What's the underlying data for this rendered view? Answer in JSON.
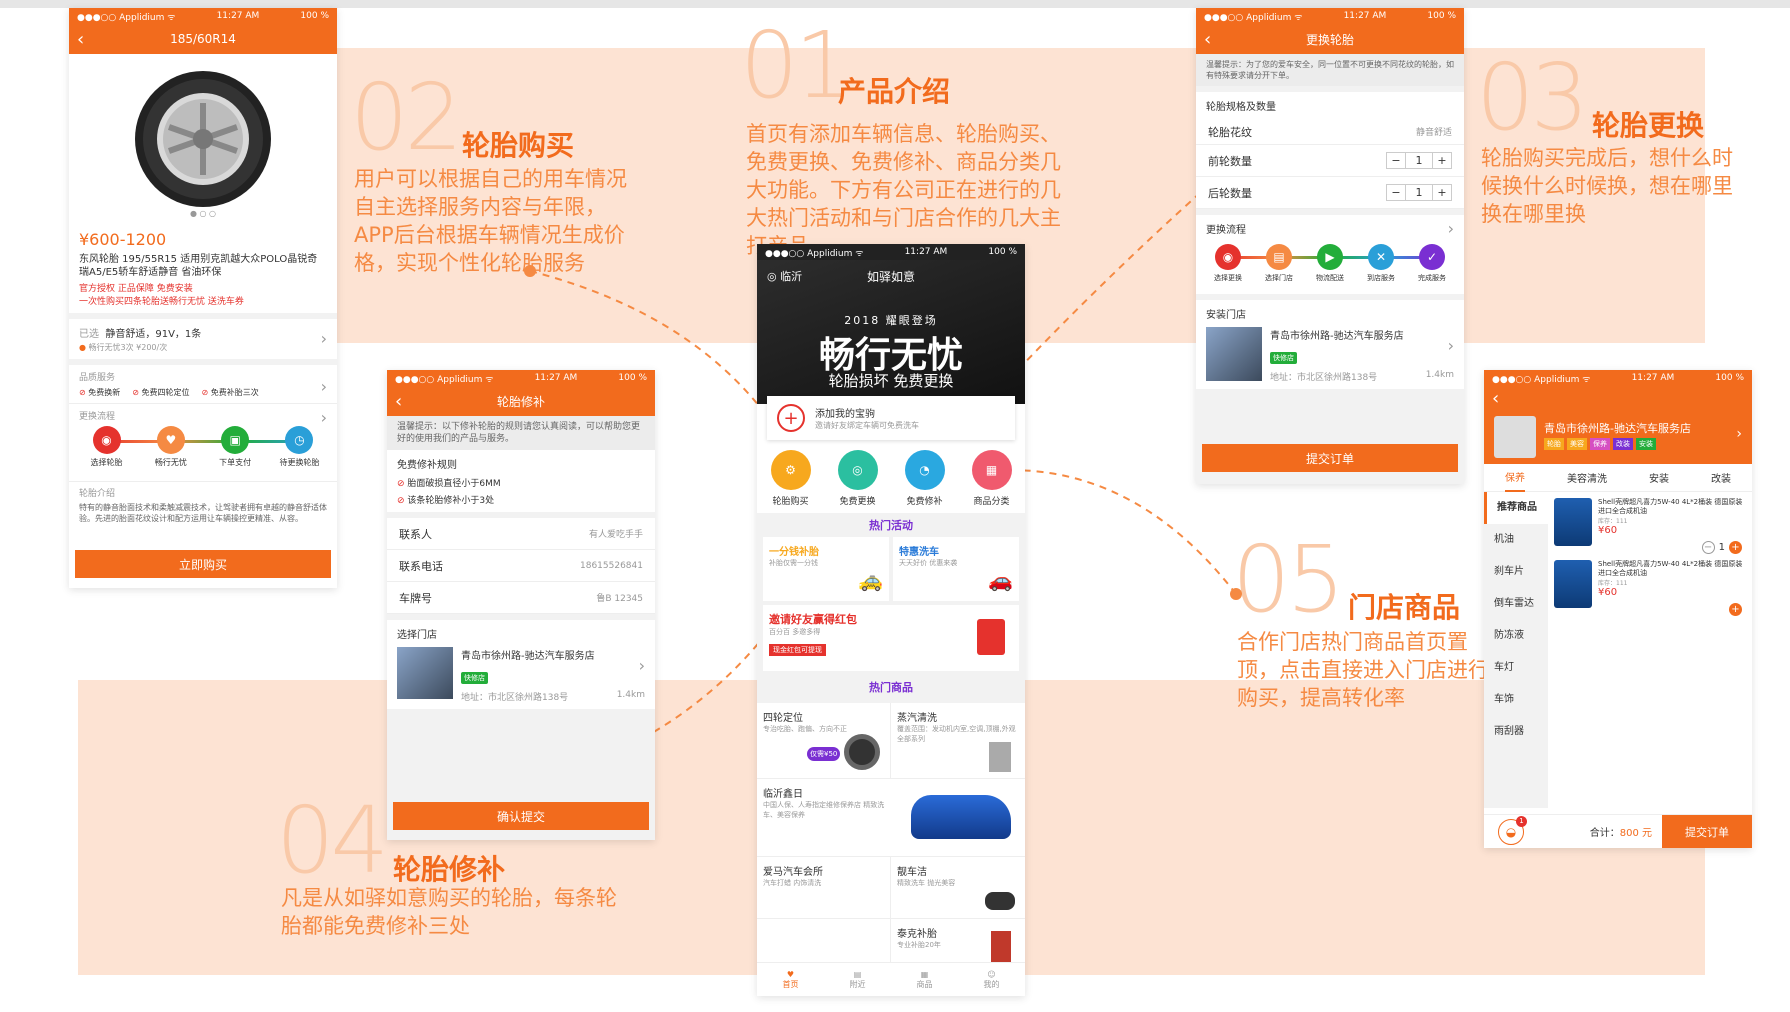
{
  "features": {
    "f01": {
      "num": "01",
      "title": "产品介绍",
      "desc": "首页有添加车辆信息、轮胎购买、免费更换、免费修补、商品分类几大功能。下方有公司正在进行的几大热门活动和与门店合作的几大主打产品"
    },
    "f02": {
      "num": "02",
      "title": "轮胎购买",
      "desc": "用户可以根据自己的用车情况自主选择服务内容与年限，APP后台根据车辆情况生成价格，实现个性化轮胎服务"
    },
    "f03": {
      "num": "03",
      "title": "轮胎更换",
      "desc": "轮胎购买完成后，想什么时候换什么时候换，想在哪里换在哪里换"
    },
    "f04": {
      "num": "04",
      "title": "轮胎修补",
      "desc": "凡是从如驿如意购买的轮胎，每条轮胎都能免费修补三处"
    },
    "f05": {
      "num": "05",
      "title": "门店商品",
      "desc": "合作门店热门商品首页置顶，点击直接进入门店进行购买，提高转化率"
    }
  },
  "statusbar": {
    "carrier": "●●●○○ Applidium ᯤ",
    "time": "11:27 AM",
    "battery": "100 %"
  },
  "screen_tire": {
    "title": "185/60R14",
    "price": "¥600-1200",
    "name": "东风轮胎 195/55R15 适用别克凯越大众POLO晶锐奇瑞A5/E5轿车舒适静音 省油环保",
    "promo1": "官方授权 正品保障 免费安装",
    "promo2": "一次性购买四条轮胎送畅行无忧 送洗车券",
    "selected_label": "已选",
    "selected_value": "静音舒适，91V，1条",
    "selected_sub": "畅行无忧3次  ¥200/次",
    "quality_label": "品质服务",
    "quality_items": [
      "免费换新",
      "免费四轮定位",
      "免费补胎三次"
    ],
    "process_label": "更换流程",
    "steps": [
      "选择轮胎",
      "畅行无忧",
      "下单支付",
      "待更换轮胎"
    ],
    "intro_label": "轮胎介绍",
    "intro_text": "特有的静音胎面技术和柔触减震技术，让驾驶者拥有卓越的静音舒适体验。先进的胎面花纹设计和配方运用让车辆操控更精准、从容。",
    "buy_button": "立即购买"
  },
  "screen_repair": {
    "title": "轮胎修补",
    "notice": "温馨提示：以下修补轮胎的规则请您认真阅读，可以帮助您更好的使用我们的产品与服务。",
    "rules_label": "免费修补规则",
    "rules": [
      "胎面破损直径小于6MM",
      "该条轮胎修补小于3处"
    ],
    "contact_label": "联系人",
    "contact_value": "有人爱吃手手",
    "phone_label": "联系电话",
    "phone_value": "18615526841",
    "plate_label": "车牌号",
    "plate_value": "鲁B 12345",
    "store_label": "选择门店",
    "store_name": "青岛市徐州路-驰达汽车服务店",
    "store_tag": "快修店",
    "store_addr": "地址：市北区徐州路138号",
    "store_dist": "1.4km",
    "submit": "确认提交"
  },
  "screen_home": {
    "city": "临沂",
    "title": "如驿如意",
    "banner_year": "2018 耀眼登场",
    "banner_main": "畅行无忧",
    "banner_sub": "轮胎损坏 免费更换",
    "add_car_title": "添加我的宝驹",
    "add_car_sub": "邀请好友绑定车辆可免费洗车",
    "icons": [
      "轮胎购买",
      "免费更换",
      "免费修补",
      "商品分类"
    ],
    "hot_activity": "热门活动",
    "act1_title": "一分钱补胎",
    "act1_sub": "补胎仅需一分钱",
    "act2_title": "特惠洗车",
    "act2_sub": "天天好价 优惠来袭",
    "act3_title": "邀请好友赢得红包",
    "act3_sub": "百分百 多邀多得",
    "act3_tag": "现金红包可提现",
    "hot_goods": "热门商品",
    "goods": [
      {
        "title": "四轮定位",
        "sub": "专治吃胎、跑偏、方向不正",
        "badge": "仅需¥50"
      },
      {
        "title": "蒸汽清洗",
        "sub": "覆盖范围：发动机内室,空调,顶棚,外观全部系列"
      },
      {
        "title": "临沂鑫日",
        "sub": "中国人保、人寿指定维修保养店 精致洗车、美容保养"
      },
      {
        "title": "爱马汽车会所",
        "sub": "汽车打蜡 内饰清洗"
      },
      {
        "title": "靓车洁",
        "sub": "精致洗车 抛光美容"
      },
      {
        "title": "泰克补胎",
        "sub": "专业补胎20年"
      }
    ],
    "tabs": [
      "首页",
      "附近",
      "商品",
      "我的"
    ]
  },
  "screen_change": {
    "title": "更换轮胎",
    "notice": "温馨提示：为了您的爱车安全，同一位置不可更换不同花纹的轮胎，如有特殊要求请分开下单。",
    "spec_label": "轮胎规格及数量",
    "pattern_label": "轮胎花纹",
    "pattern_value": "静音舒适",
    "front_label": "前轮数量",
    "front_value": "1",
    "rear_label": "后轮数量",
    "rear_value": "1",
    "process_label": "更换流程",
    "steps": [
      "选择更换",
      "选择门店",
      "物流配送",
      "到店服务",
      "完成服务"
    ],
    "store_label": "安装门店",
    "store_name": "青岛市徐州路-驰达汽车服务店",
    "store_tag": "快修店",
    "store_addr": "地址：市北区徐州路138号",
    "store_dist": "1.4km",
    "submit": "提交订单"
  },
  "screen_store": {
    "store_name": "青岛市徐州路-驰达汽车服务店",
    "store_tags": [
      "轮胎",
      "美容",
      "保养",
      "改装",
      "安装"
    ],
    "tabs": [
      "保养",
      "美容清洗",
      "安装",
      "改装"
    ],
    "categories": [
      "推荐商品",
      "机油",
      "刹车片",
      "倒车雷达",
      "防冻液",
      "车灯",
      "车饰",
      "雨刮器"
    ],
    "products": [
      {
        "name": "Shell壳牌超凡喜力5W-40 4L*2桶装 德国原装进口全合成机油",
        "stock": "库存：111",
        "price": "¥60",
        "qty": "1"
      },
      {
        "name": "Shell壳牌超凡喜力5W-40 4L*2桶装 德国原装进口全合成机油",
        "stock": "库存：111",
        "price": "¥60"
      }
    ],
    "cart_badge": "1",
    "total_label": "合计：",
    "total_value": "800 元",
    "submit": "提交订单"
  }
}
